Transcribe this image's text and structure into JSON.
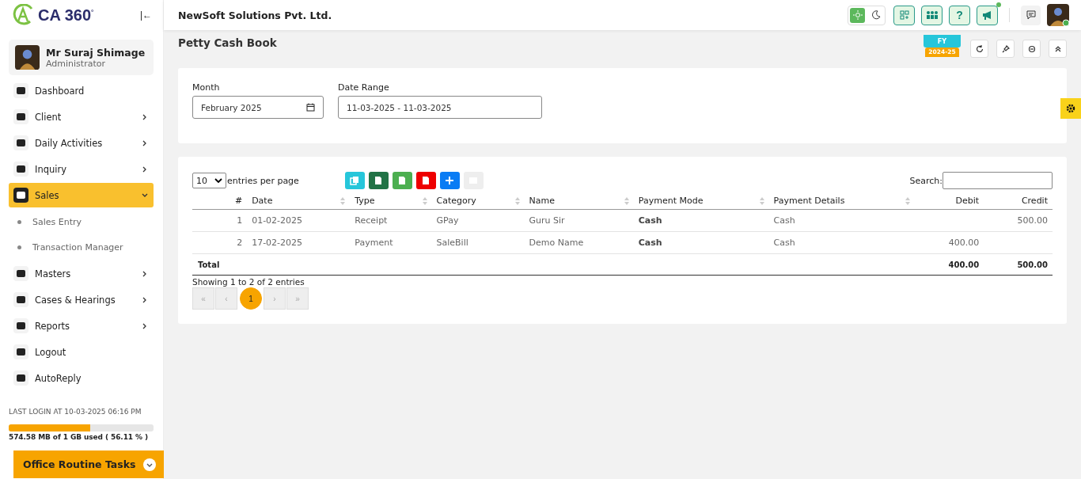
{
  "brand": {
    "logo_text": "CA 360",
    "mark": "°"
  },
  "collapse_icon": "|←",
  "user": {
    "name": "Mr Suraj Shimage",
    "role": "Administrator"
  },
  "nav": [
    {
      "label": "Dashboard",
      "kind": "link",
      "selected": false
    },
    {
      "label": "Client",
      "kind": "group",
      "expanded": false,
      "selected": false
    },
    {
      "label": "Daily Activities",
      "kind": "group",
      "expanded": false,
      "selected": false
    },
    {
      "label": "Inquiry",
      "kind": "group",
      "expanded": false,
      "selected": false
    },
    {
      "label": "Sales",
      "kind": "group",
      "expanded": true,
      "selected": true,
      "children": [
        {
          "label": "Sales Entry"
        },
        {
          "label": "Transaction Manager"
        }
      ]
    },
    {
      "label": "Masters",
      "kind": "group",
      "expanded": false,
      "selected": false
    },
    {
      "label": "Cases & Hearings",
      "kind": "group",
      "expanded": false,
      "selected": false
    },
    {
      "label": "Reports",
      "kind": "group",
      "expanded": false,
      "selected": false
    },
    {
      "label": "Logout",
      "kind": "link",
      "selected": false
    },
    {
      "label": "AutoReply",
      "kind": "link",
      "selected": false
    }
  ],
  "last_login": "LAST LOGIN AT 10-03-2025 06:16 PM",
  "storage": {
    "level": 0.5611,
    "reading": "574.58 MB of 1 GB used ( 56.11 % )"
  },
  "office_tasks": {
    "label": "Office Routine Tasks"
  },
  "header": {
    "company": "NewSoft Solutions Pvt. Ltd.",
    "help": "?",
    "theme_modes": [
      {
        "kind": "light",
        "selected": true
      },
      {
        "kind": "dark",
        "selected": false
      }
    ]
  },
  "page": {
    "title": "Petty Cash Book",
    "fy": {
      "year": "2024-25",
      "label": "FY"
    }
  },
  "filters": [
    {
      "label": "Month",
      "value": "February 2025",
      "kind": "month"
    },
    {
      "label": "Date Range",
      "value": "11-03-2025 - 11-03-2025",
      "kind": "text"
    }
  ],
  "table": {
    "page_size": "10",
    "page_size_label": "entries per page",
    "search_label": "Search:",
    "columns": [
      "#",
      "Date",
      "Type",
      "Category",
      "Name",
      "Payment Mode",
      "Payment Details",
      "Debit",
      "Credit"
    ],
    "rows": [
      [
        "1",
        "01-02-2025",
        "Receipt",
        "GPay",
        "Guru Sir",
        "Cash",
        "Cash",
        "",
        "500.00"
      ],
      [
        "2",
        "17-02-2025",
        "Payment",
        "SaleBill",
        "Demo Name",
        "Cash",
        "Cash",
        "400.00",
        ""
      ]
    ],
    "total": {
      "label": "Total",
      "debit": "400.00",
      "credit": "500.00"
    },
    "info": "Showing 1 to 2 of 2 entries",
    "pager": [
      {
        "label": "«",
        "selected": false
      },
      {
        "label": "‹",
        "selected": false
      },
      {
        "label": "1",
        "selected": true
      },
      {
        "label": "›",
        "selected": false
      },
      {
        "label": "»",
        "selected": false
      }
    ]
  }
}
